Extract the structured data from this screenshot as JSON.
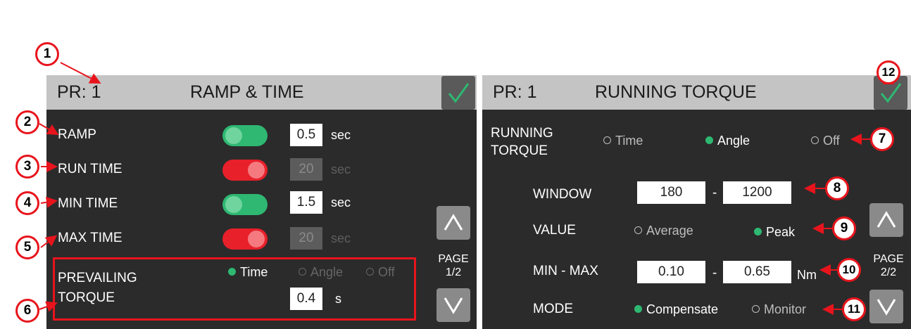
{
  "accent": "#2eb872",
  "callout_color": "#e8141c",
  "left_panel": {
    "pr": "PR: 1",
    "title": "RAMP & TIME",
    "rows": [
      {
        "label": "RAMP",
        "toggle_state": "on",
        "value": "0.5",
        "unit": "sec"
      },
      {
        "label": "RUN TIME",
        "toggle_state": "off",
        "value": "20",
        "unit": "sec"
      },
      {
        "label": "MIN TIME",
        "toggle_state": "on",
        "value": "1.5",
        "unit": "sec"
      },
      {
        "label": "MAX TIME",
        "toggle_state": "off",
        "value": "20",
        "unit": "sec"
      }
    ],
    "prevailing": {
      "label_line1": "PREVAILING",
      "label_line2": "TORQUE",
      "options": [
        "Time",
        "Angle",
        "Off"
      ],
      "selected": "Time",
      "value": "0.4",
      "unit": "s"
    },
    "page_label": "PAGE",
    "page_num": "1/2",
    "up_icon": "chevron-up-icon",
    "down_icon": "chevron-down-icon"
  },
  "right_panel": {
    "pr": "PR: 1",
    "title": "RUNNING TORQUE",
    "running_torque": {
      "label_line1": "RUNNING",
      "label_line2": "TORQUE",
      "options": [
        "Time",
        "Angle",
        "Off"
      ],
      "selected": "Angle"
    },
    "window": {
      "label": "WINDOW",
      "from": "180",
      "to": "1200",
      "sep": "-"
    },
    "value": {
      "label": "VALUE",
      "options": [
        "Average",
        "Peak"
      ],
      "selected": "Peak"
    },
    "min_max": {
      "label": "MIN - MAX",
      "min": "0.10",
      "max": "0.65",
      "sep": "-",
      "unit": "Nm"
    },
    "mode": {
      "label": "MODE",
      "options": [
        "Compensate",
        "Monitor"
      ],
      "selected": "Compensate"
    },
    "page_label": "PAGE",
    "page_num": "2/2"
  },
  "callouts": [
    "1",
    "2",
    "3",
    "4",
    "5",
    "6",
    "7",
    "8",
    "9",
    "10",
    "11",
    "12"
  ]
}
